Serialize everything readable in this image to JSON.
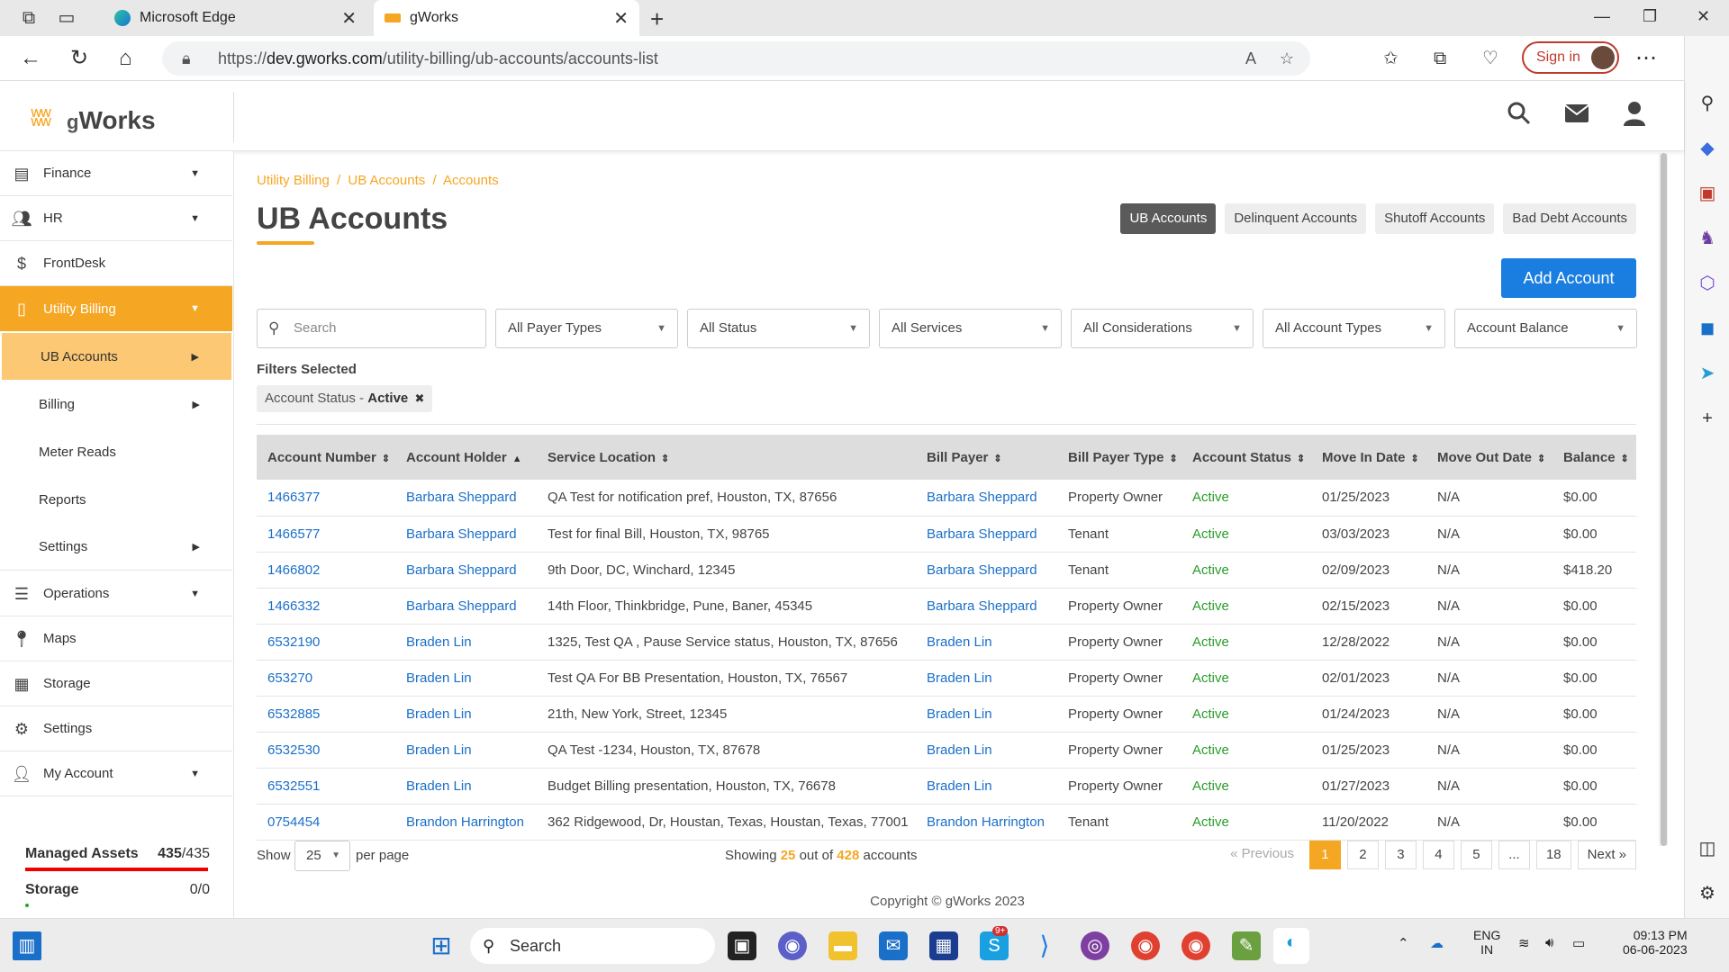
{
  "browser": {
    "tabs": [
      {
        "title": "Microsoft Edge"
      },
      {
        "title": "gWorks"
      }
    ],
    "url_prefix": "https://",
    "url_domain": "dev.gworks.com",
    "url_path": "/utility-billing/ub-accounts/accounts-list",
    "signin_label": "Sign in"
  },
  "logo": {
    "crown": "ʬʬ",
    "text_g": "g",
    "text_works": "Works"
  },
  "sidebar": {
    "items": [
      {
        "label": "Finance"
      },
      {
        "label": "HR"
      },
      {
        "label": "FrontDesk"
      },
      {
        "label": "Utility Billing"
      },
      {
        "label": "Operations"
      },
      {
        "label": "Maps"
      },
      {
        "label": "Storage"
      },
      {
        "label": "Settings"
      },
      {
        "label": "My Account"
      }
    ],
    "sub_items": [
      {
        "label": "UB Accounts"
      },
      {
        "label": "Billing"
      },
      {
        "label": "Meter Reads"
      },
      {
        "label": "Reports"
      },
      {
        "label": "Settings"
      }
    ],
    "managed_assets_label": "Managed Assets",
    "managed_assets_used": "435",
    "managed_assets_total": "/435",
    "storage_label": "Storage",
    "storage_value": "0/0"
  },
  "breadcrumb": [
    "Utility Billing",
    "/",
    "UB Accounts",
    "/",
    "Accounts"
  ],
  "page_title": "UB Accounts",
  "section_tabs": [
    "UB Accounts",
    "Delinquent Accounts",
    "Shutoff Accounts",
    "Bad Debt Accounts"
  ],
  "add_account_label": "Add Account",
  "filters": {
    "search_placeholder": "Search",
    "payer_types": "All Payer Types",
    "status": "All Status",
    "services": "All Services",
    "considerations": "All Considerations",
    "account_types": "All Account Types",
    "balance": "Account Balance"
  },
  "filters_selected_label": "Filters Selected",
  "chip": {
    "key": "Account Status - ",
    "value": "Active",
    "remove": "✖"
  },
  "table": {
    "headers": [
      "Account Number",
      "Account Holder",
      "Service Location",
      "Bill Payer",
      "Bill Payer Type",
      "Account Status",
      "Move In Date",
      "Move Out Date",
      "Balance"
    ],
    "rows": [
      [
        "1466377",
        "Barbara Sheppard",
        "QA Test for notification pref, Houston, TX, 87656",
        "Barbara Sheppard",
        "Property Owner",
        "Active",
        "01/25/2023",
        "N/A",
        "$0.00"
      ],
      [
        "1466577",
        "Barbara Sheppard",
        "Test for final Bill, Houston, TX, 98765",
        "Barbara Sheppard",
        "Tenant",
        "Active",
        "03/03/2023",
        "N/A",
        "$0.00"
      ],
      [
        "1466802",
        "Barbara Sheppard",
        "9th Door, DC, Winchard, 12345",
        "Barbara Sheppard",
        "Tenant",
        "Active",
        "02/09/2023",
        "N/A",
        "$418.20"
      ],
      [
        "1466332",
        "Barbara Sheppard",
        "14th Floor, Thinkbridge, Pune, Baner, 45345",
        "Barbara Sheppard",
        "Property Owner",
        "Active",
        "02/15/2023",
        "N/A",
        "$0.00"
      ],
      [
        "6532190",
        "Braden Lin",
        "1325, Test QA , Pause Service status, Houston, TX, 87656",
        "Braden Lin",
        "Property Owner",
        "Active",
        "12/28/2022",
        "N/A",
        "$0.00"
      ],
      [
        "653270",
        "Braden Lin",
        "Test QA For BB Presentation, Houston, TX, 76567",
        "Braden Lin",
        "Property Owner",
        "Active",
        "02/01/2023",
        "N/A",
        "$0.00"
      ],
      [
        "6532885",
        "Braden Lin",
        "21th, New York, Street, 12345",
        "Braden Lin",
        "Property Owner",
        "Active",
        "01/24/2023",
        "N/A",
        "$0.00"
      ],
      [
        "6532530",
        "Braden Lin",
        "QA Test -1234, Houston, TX, 87678",
        "Braden Lin",
        "Property Owner",
        "Active",
        "01/25/2023",
        "N/A",
        "$0.00"
      ],
      [
        "6532551",
        "Braden Lin",
        "Budget Billing presentation, Houston, TX, 76678",
        "Braden Lin",
        "Property Owner",
        "Active",
        "01/27/2023",
        "N/A",
        "$0.00"
      ],
      [
        "0754454",
        "Brandon Harrington",
        "362 Ridgewood, Dr, Houstan, Texas, Houstan, Texas, 77001",
        "Brandon Harrington",
        "Tenant",
        "Active",
        "11/20/2022",
        "N/A",
        "$0.00"
      ]
    ]
  },
  "pager": {
    "show_label": "Show",
    "per_page_value": "25",
    "per_page_label": "per page",
    "showing_prefix": "Showing",
    "showing_count": "25",
    "showing_mid": "out of",
    "showing_total": "428",
    "showing_suffix": "accounts",
    "previous": "« Previous",
    "pages": [
      "1",
      "2",
      "3",
      "4",
      "5",
      "...",
      "18"
    ],
    "next": "Next »"
  },
  "copyright": "Copyright © gWorks 2023",
  "taskbar": {
    "search_label": "Search",
    "badge": "9+",
    "lang": "ENG",
    "region": "IN",
    "time": "09:13 PM",
    "date": "06-06-2023"
  },
  "colors": {
    "accent": "#f5a623",
    "link": "#1a6fc9",
    "active": "#2a9d2a",
    "primary": "#1a7de0"
  }
}
